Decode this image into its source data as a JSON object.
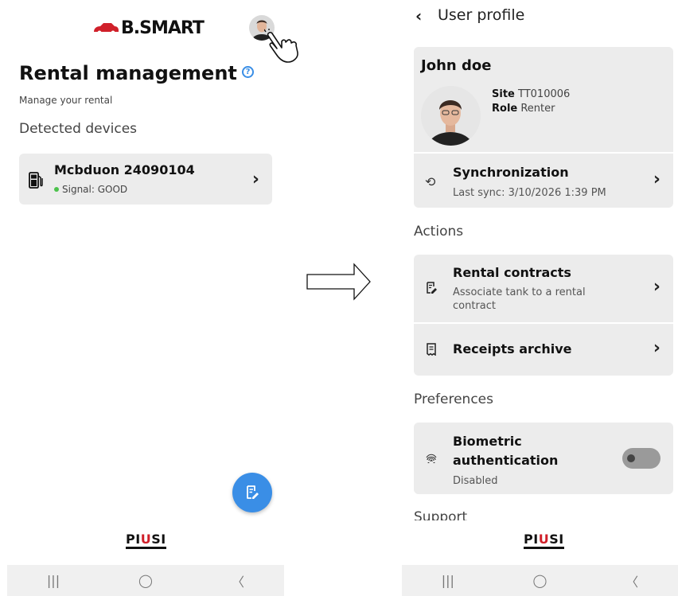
{
  "left": {
    "brand": "B.SMART",
    "title": "Rental management",
    "subtitle": "Manage your rental",
    "section": "Detected devices",
    "device": {
      "name": "Mcbduon 24090104",
      "signal": "Signal: GOOD"
    },
    "footer_logo": "PIUSI"
  },
  "right": {
    "header": "User profile",
    "profile": {
      "name": "John doe",
      "site_label": "Site",
      "site_value": "TT010006",
      "role_label": "Role",
      "role_value": "Renter"
    },
    "sync": {
      "title": "Synchronization",
      "sub": "Last sync: 3/10/2026 1:39 PM"
    },
    "actions_label": "Actions",
    "rental_contracts": {
      "title": "Rental contracts",
      "sub": "Associate tank to a rental contract"
    },
    "receipts": {
      "title": "Receipts archive"
    },
    "preferences_label": "Preferences",
    "biometric": {
      "title": "Biometric authentication",
      "sub": "Disabled",
      "enabled": false
    },
    "support_label": "Support",
    "footer_logo": "PIUSI"
  },
  "nav": {
    "recents": "|||",
    "home": "◯",
    "back": "〈"
  },
  "colors": {
    "accent": "#3a8ee6",
    "card": "#ececec",
    "signal_good": "#4cc24c",
    "brand_red": "#d0202a"
  }
}
